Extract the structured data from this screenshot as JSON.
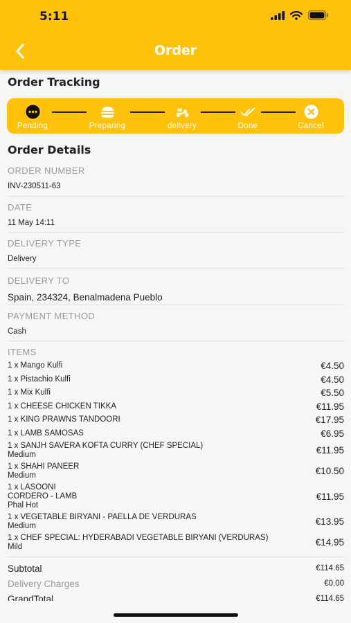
{
  "status_bar": {
    "time": "5:11"
  },
  "header": {
    "title": "Order"
  },
  "tracking": {
    "title": "Order Tracking",
    "steps": [
      {
        "label": "Pending",
        "icon": "more-dots-icon"
      },
      {
        "label": "Preparing",
        "icon": "burger-icon"
      },
      {
        "label": "delivery",
        "icon": "scooter-icon"
      },
      {
        "label": "Done",
        "icon": "double-check-icon"
      },
      {
        "label": "Cancel",
        "icon": "cancel-circle-icon"
      }
    ]
  },
  "details": {
    "title": "Order Details",
    "order_number": {
      "label": "ORDER NUMBER",
      "value": "INV-230511-63"
    },
    "date": {
      "label": "DATE",
      "value": "11 May 14:11"
    },
    "delivery_type": {
      "label": "DELIVERY TYPE",
      "value": "Delivery"
    },
    "delivery_to": {
      "label": "DELIVERY TO",
      "value": "Spain, 234324, Benalmadena Pueblo"
    },
    "payment_method": {
      "label": "PAYMENT METHOD",
      "value": "Cash"
    },
    "items_label": "ITEMS"
  },
  "items": [
    {
      "name": "1 x Mango Kulfi",
      "price": "€4.50"
    },
    {
      "name": "1 x Pistachio Kulfi",
      "price": "€4.50"
    },
    {
      "name": "1 x Mix Kulfi",
      "price": "€5.50"
    },
    {
      "name": "1 x CHEESE CHICKEN TIKKA",
      "price": "€11.95"
    },
    {
      "name": "1 x KING PRAWNS TANDOORI",
      "price": "€17.95"
    },
    {
      "name": "1 x LAMB SAMOSAS",
      "price": "€6.95"
    },
    {
      "name": "1 x SANJH SAVERA KOFTA CURRY (CHEF SPECIAL)",
      "option": "Medium",
      "price": "€11.95"
    },
    {
      "name": "1 x SHAHI PANEER",
      "option": "Medium",
      "price": "€10.50"
    },
    {
      "name": "1 x LASOONI",
      "name2": "CORDERO - LAMB",
      "option": "Phal Hot",
      "price": "€11.95"
    },
    {
      "name": "1 x VEGETABLE BIRYANI - PAELLA DE VERDURAS",
      "option": "Medium",
      "price": "€13.95"
    },
    {
      "name": "1 x CHEF SPECIAL: HYDERABADI VEGETABLE BIRYANI (VERDURAS)",
      "option": "Mild",
      "price": "€14.95"
    }
  ],
  "totals": {
    "subtotal": {
      "label": "Subtotal",
      "value": "€114.65"
    },
    "delivery": {
      "label": "Delivery Charges",
      "value": "€0.00"
    },
    "grand": {
      "label": "GrandTotal",
      "value": "€114.65"
    }
  }
}
